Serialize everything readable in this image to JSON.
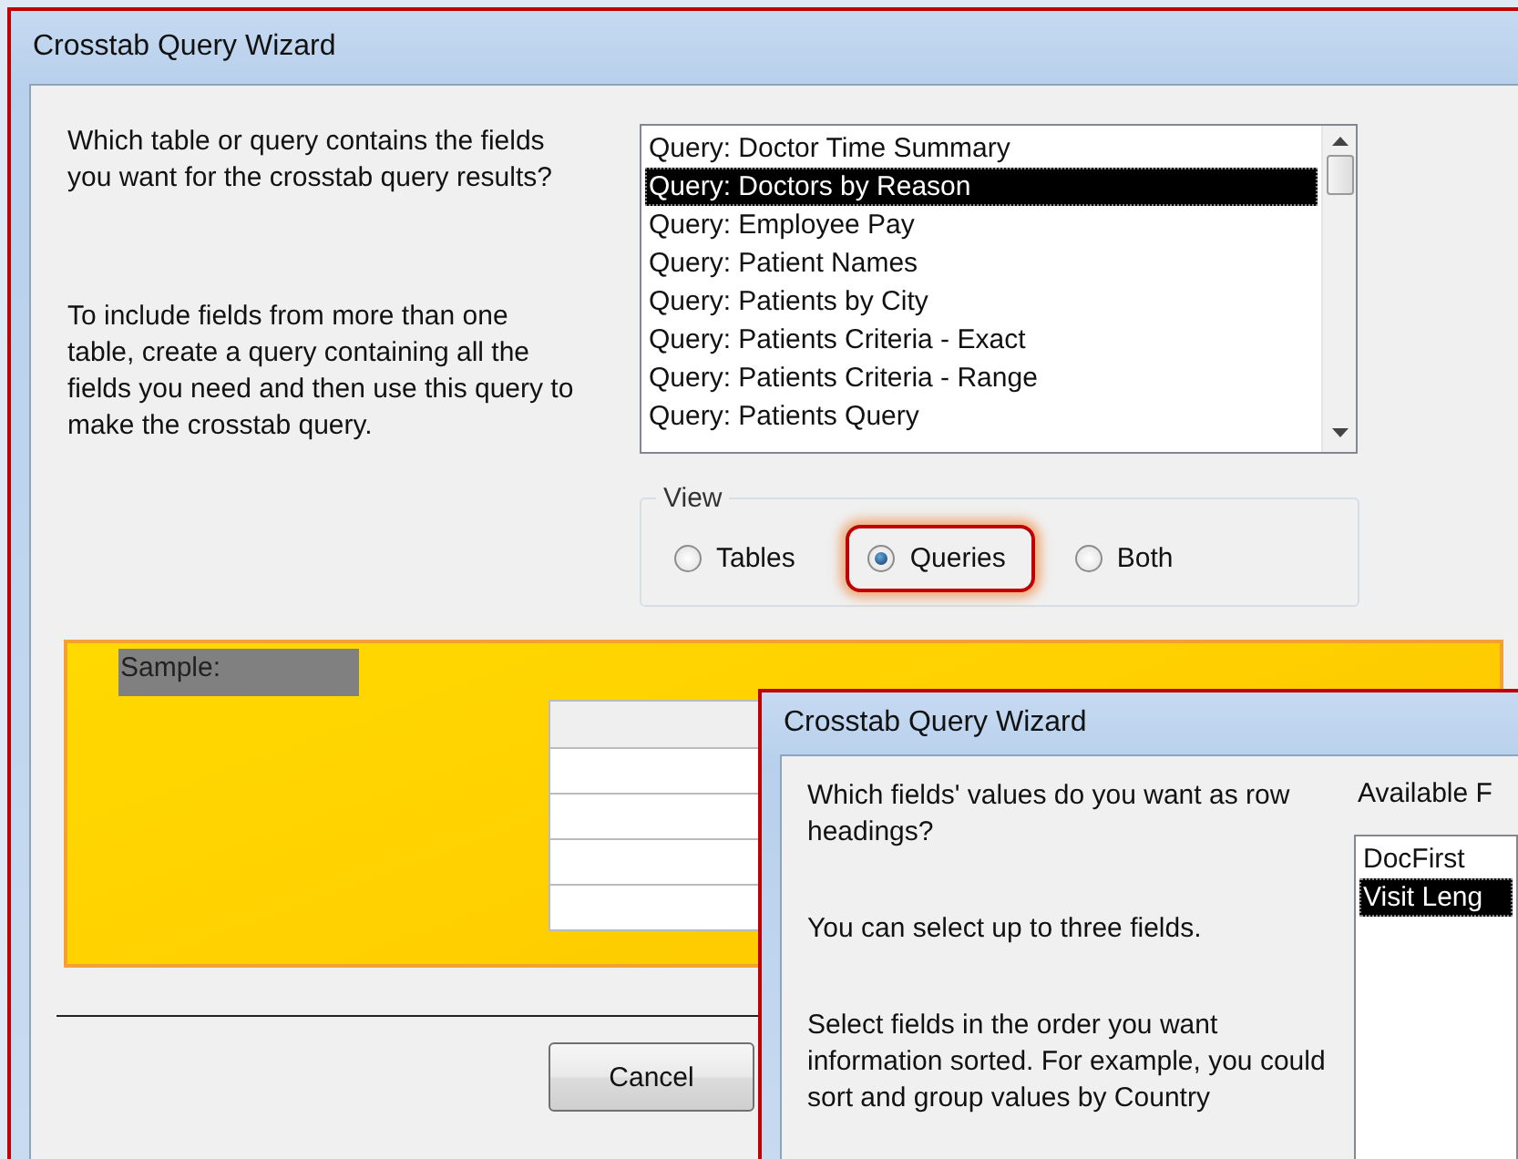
{
  "main_wizard": {
    "title": "Crosstab Query Wizard",
    "prompt": "Which table or query contains the fields you want for the crosstab query results?",
    "hint": "To include fields from more than one table, create a query containing all the fields you need and then use this query to make the crosstab query.",
    "sources": [
      {
        "label": "Query: Doctor Time Summary",
        "selected": false
      },
      {
        "label": "Query: Doctors by Reason",
        "selected": true
      },
      {
        "label": "Query: Employee Pay",
        "selected": false
      },
      {
        "label": "Query: Patient Names",
        "selected": false
      },
      {
        "label": "Query: Patients by City",
        "selected": false
      },
      {
        "label": "Query: Patients Criteria - Exact",
        "selected": false
      },
      {
        "label": "Query: Patients Criteria - Range",
        "selected": false
      },
      {
        "label": "Query: Patients Query",
        "selected": false
      }
    ],
    "view": {
      "label": "View",
      "options": [
        {
          "label": "Tables",
          "selected": false,
          "highlighted": false
        },
        {
          "label": "Queries",
          "selected": true,
          "highlighted": true
        },
        {
          "label": "Both",
          "selected": false,
          "highlighted": false
        }
      ]
    },
    "sample": {
      "label": "Sample:"
    },
    "buttons": [
      "Cancel"
    ]
  },
  "front_wizard": {
    "title": "Crosstab Query Wizard",
    "paragraphs": [
      "Which fields' values do you want as row headings?",
      "You can select up to three fields.",
      "Select fields in the order you want information sorted.  For example, you could sort and group values by Country"
    ],
    "available_label": "Available F",
    "fields": [
      {
        "label": "DocFirst",
        "selected": false
      },
      {
        "label": "Visit Leng",
        "selected": true
      }
    ]
  }
}
